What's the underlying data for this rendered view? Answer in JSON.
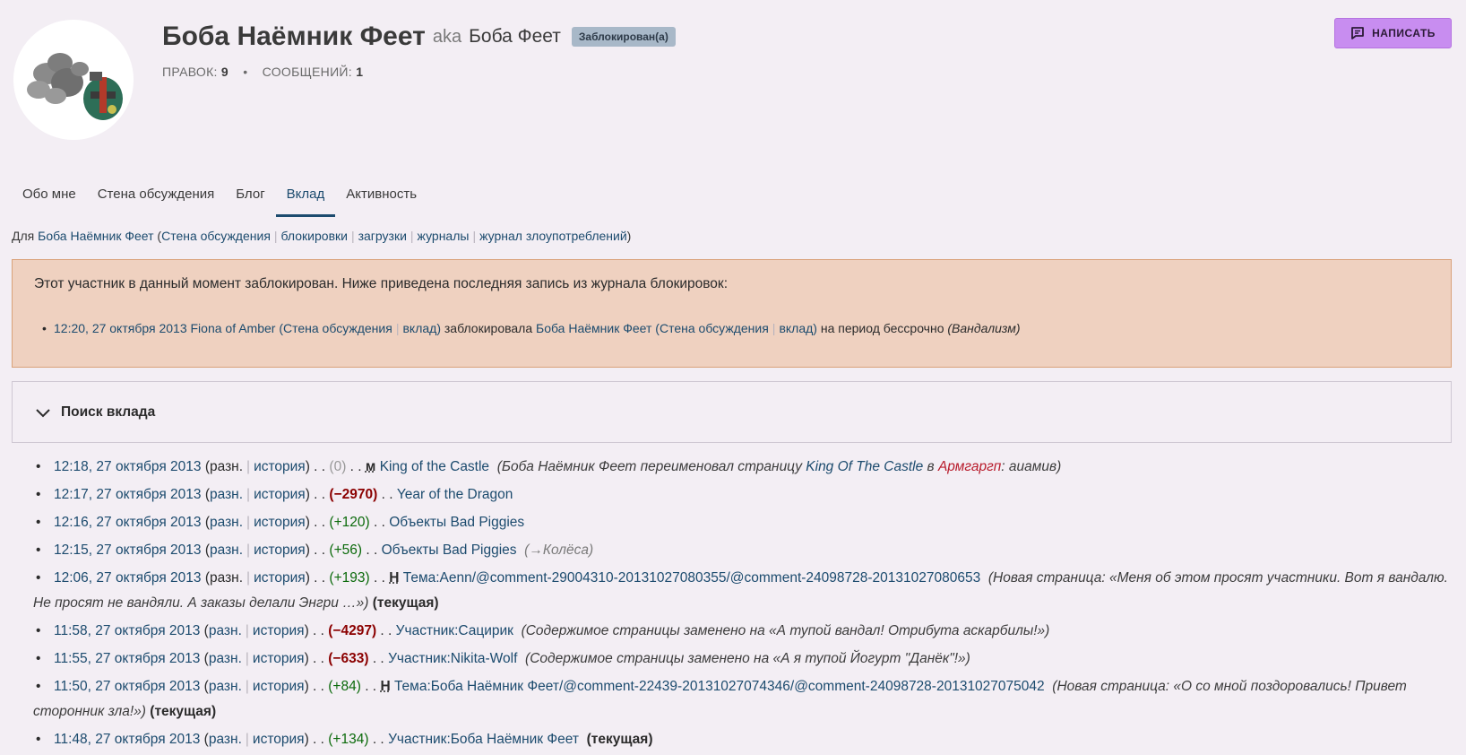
{
  "profile": {
    "name": "Боба Наёмник Феет",
    "aka_label": "aka",
    "alias": "Боба Феет",
    "badge": "Заблокирован(а)",
    "edits_label": "ПРАВОК:",
    "edits_count": "9",
    "messages_label": "СООБЩЕНИЙ:",
    "messages_count": "1",
    "write_button": "НАПИСАТЬ"
  },
  "tabs": [
    "Обо мне",
    "Стена обсуждения",
    "Блог",
    "Вклад",
    "Активность"
  ],
  "active_tab": "Вклад",
  "for_line": {
    "prefix": "Для",
    "user": "Боба Наёмник Феет",
    "links": [
      "Стена обсуждения",
      "блокировки",
      "загрузки",
      "журналы",
      "журнал злоупотреблений"
    ]
  },
  "block_notice": {
    "text": "Этот участник в данный момент заблокирован. Ниже приведена последняя запись из журнала блокировок:",
    "time": "12:20, 27 октября 2013",
    "admin": "Fiona of Amber",
    "talk": "Стена обсуждения",
    "contribs": "вклад",
    "action": "заблокировала",
    "target": "Боба Наёмник Феет",
    "duration": "на период бессрочно",
    "reason": "(Вандализм)"
  },
  "search": {
    "title": "Поиск вклада"
  },
  "labels": {
    "diff": "разн.",
    "hist": "история",
    "current": "(текущая)"
  },
  "contributions": [
    {
      "time": "12:18, 27 октября 2013",
      "diff_link": false,
      "size": "(0)",
      "size_class": "zero",
      "flag": "м",
      "page": "King of the Castle",
      "comment_pre": "Боба Наёмник Феет переименовал страницу ",
      "comment_link1": "King Of The Castle",
      "comment_mid": " в ",
      "comment_link2": "Армгаргп",
      "comment_post": ": аиамив"
    },
    {
      "time": "12:17, 27 октября 2013",
      "diff_link": true,
      "size": "(−2970)",
      "size_class": "neg",
      "page": "Year of the Dragon"
    },
    {
      "time": "12:16, 27 октября 2013",
      "diff_link": true,
      "size": "(+120)",
      "size_class": "pos",
      "page": "Объекты Bad Piggies"
    },
    {
      "time": "12:15, 27 октября 2013",
      "diff_link": true,
      "size": "(+56)",
      "size_class": "pos",
      "page": "Объекты Bad Piggies",
      "autocomment": "(→Колёса)"
    },
    {
      "time": "12:06, 27 октября 2013",
      "diff_link": false,
      "size": "(+193)",
      "size_class": "pos",
      "flag": "Н",
      "page": "Тема:Aenn/@comment-29004310-20131027080355/@comment-24098728-20131027080653",
      "comment": "(Новая страница: «Меня об этом просят участники. Вот я вандалю. Не просят не вандяли. А заказы делали Энгри …»)",
      "current": true
    },
    {
      "time": "11:58, 27 октября 2013",
      "diff_link": true,
      "size": "(−4297)",
      "size_class": "neg",
      "page": "Участник:Сацирик",
      "comment": "(Содержимое страницы заменено на «А тупой вандал! Отрибута аскарбилы!»)"
    },
    {
      "time": "11:55, 27 октября 2013",
      "diff_link": true,
      "size": "(−633)",
      "size_class": "neg",
      "page": "Участник:Nikita-Wolf",
      "comment": "(Содержимое страницы заменено на «А я тупой Йогурт \"Данёк\"!»)"
    },
    {
      "time": "11:50, 27 октября 2013",
      "diff_link": true,
      "size": "(+84)",
      "size_class": "pos",
      "flag": "Н",
      "page": "Тема:Боба Наёмник Феет/@comment-22439-20131027074346/@comment-24098728-20131027075042",
      "comment": "(Новая страница: «О со мной поздоровались! Привет сторонник зла!»)",
      "current": true
    },
    {
      "time": "11:48, 27 октября 2013",
      "diff_link": true,
      "size": "(+134)",
      "size_class": "pos",
      "page": "Участник:Боба Наёмник Феет",
      "current": true
    }
  ]
}
